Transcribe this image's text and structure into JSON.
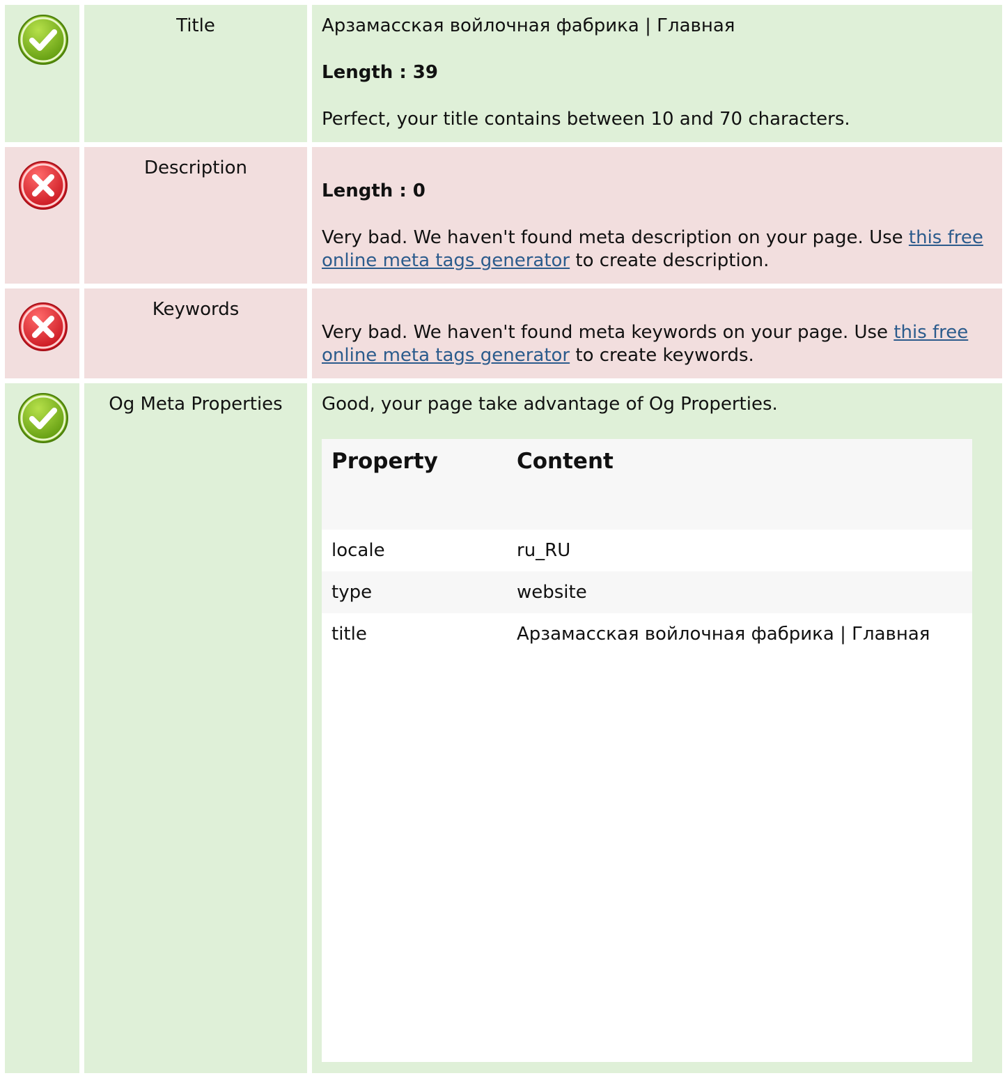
{
  "rows": {
    "title": {
      "status": "ok",
      "label": "Title",
      "value": "Арзамасская войлочная фабрика | Главная",
      "length_text": "Length : 39",
      "message": "Perfect, your title contains between 10 and 70 characters."
    },
    "description": {
      "status": "bad",
      "label": "Description",
      "length_text": "Length : 0",
      "message_before": "Very bad. We haven't found meta description on your page. Use ",
      "link_text": "this free online meta tags generator",
      "message_after": " to create description."
    },
    "keywords": {
      "status": "bad",
      "label": "Keywords",
      "message_before": "Very bad. We haven't found meta keywords on your page. Use ",
      "link_text": "this free online meta tags generator",
      "message_after": " to create keywords."
    },
    "og": {
      "status": "ok",
      "label": "Og Meta Properties",
      "message": "Good, your page take advantage of Og Properties.",
      "table": {
        "headers": [
          "Property",
          "Content"
        ],
        "rows": [
          {
            "property": "locale",
            "content": "ru_RU"
          },
          {
            "property": "type",
            "content": "website"
          },
          {
            "property": "title",
            "content": "Арзамасская войлочная фабрика | Главная"
          }
        ]
      }
    }
  },
  "icons": {
    "ok": "check-icon",
    "bad": "cross-icon"
  },
  "colors": {
    "ok_bg": "#dff0d8",
    "bad_bg": "#f2dede",
    "link": "#2b5b8c",
    "ok_icon": "#7cb518",
    "bad_icon": "#e0303a"
  }
}
